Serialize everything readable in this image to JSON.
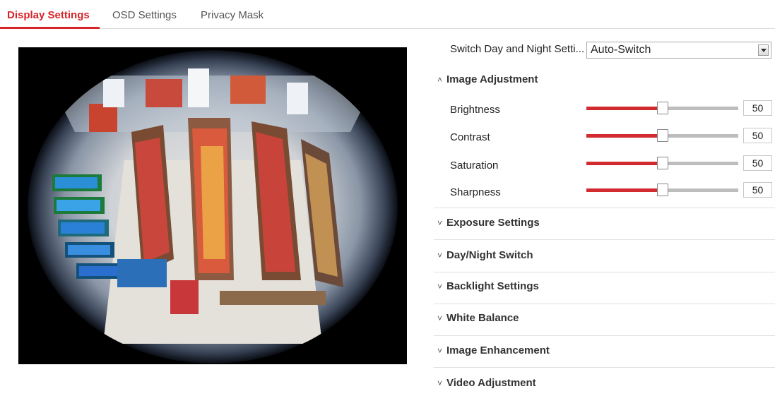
{
  "tabs": [
    {
      "label": "Display Settings",
      "active": true
    },
    {
      "label": "OSD Settings",
      "active": false
    },
    {
      "label": "Privacy Mask",
      "active": false
    }
  ],
  "accent_color": "#d7242a",
  "switch_day_night": {
    "label": "Switch Day and Night Setti...",
    "value": "Auto-Switch"
  },
  "image_adjustment": {
    "title": "Image Adjustment",
    "expanded": true,
    "sliders": [
      {
        "label": "Brightness",
        "value": "50",
        "percent": 50
      },
      {
        "label": "Contrast",
        "value": "50",
        "percent": 50
      },
      {
        "label": "Saturation",
        "value": "50",
        "percent": 50
      },
      {
        "label": "Sharpness",
        "value": "50",
        "percent": 50
      }
    ]
  },
  "collapsed_sections": [
    {
      "title": "Exposure Settings"
    },
    {
      "title": "Day/Night Switch"
    },
    {
      "title": "Backlight Settings"
    },
    {
      "title": "White Balance"
    },
    {
      "title": "Image Enhancement"
    },
    {
      "title": "Video Adjustment"
    }
  ],
  "icons": {
    "expand": "chevron-up-icon",
    "collapse": "chevron-down-icon",
    "dropdown": "dropdown-arrow-icon"
  }
}
